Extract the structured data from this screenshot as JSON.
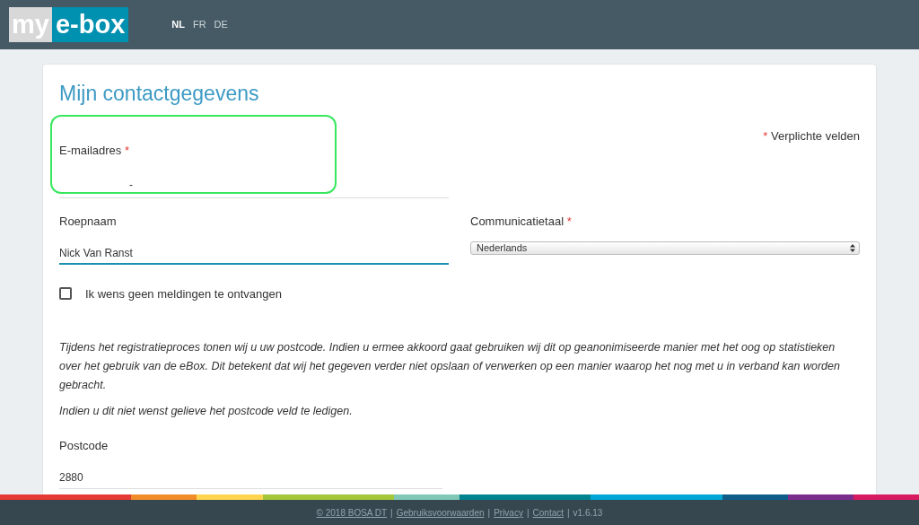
{
  "logo": {
    "part_1": "my",
    "part_2": "e-box"
  },
  "languages": [
    {
      "label": "NL",
      "selected": true
    },
    {
      "label": "FR",
      "selected": false
    },
    {
      "label": "DE",
      "selected": false
    }
  ],
  "title": "Mijn contactgegevens",
  "required_note": {
    "mark": "*",
    "text": "Verplichte velden"
  },
  "email": {
    "label": "E-mailadres",
    "required_mark": "*",
    "value": "-"
  },
  "nickname": {
    "label": "Roepnaam",
    "value": "Nick Van Ranst",
    "focused": true
  },
  "language_select": {
    "label": "Communicatietaal",
    "required_mark": "*",
    "value": "Nederlands"
  },
  "no_notifications": {
    "label": "Ik wens geen meldingen te ontvangen",
    "checked": false
  },
  "info_paragraphs": [
    "Tijdens het registratieproces tonen wij u uw postcode. Indien u ermee akkoord gaat gebruiken wij dit op geanonimiseerde manier met het oog op statistieken over het gebruik van de eBox. Dit betekent dat wij het gegeven verder niet opslaan of verwerken op een manier waarop het nog met u in verband kan worden gebracht.",
    "Indien u dit niet wenst gelieve het postcode veld te ledigen."
  ],
  "postcode": {
    "label": "Postcode",
    "value": "2880"
  },
  "footer": {
    "links": [
      "© 2018 BOSA DT",
      "Gebruiksvoorwaarden",
      "Privacy",
      "Contact"
    ],
    "separator": "|",
    "version": "v1.6.13"
  }
}
